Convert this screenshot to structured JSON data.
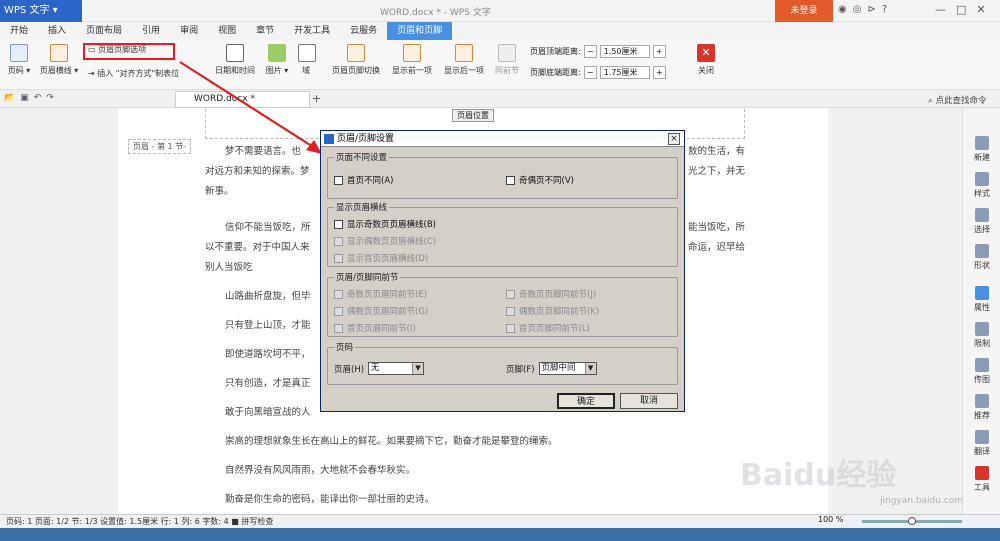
{
  "titlebar": {
    "app": "WPS 文字",
    "doc_title": "WORD.docx * - WPS 文字",
    "login": "未登录"
  },
  "tabs": [
    "开始",
    "插入",
    "页面布局",
    "引用",
    "审阅",
    "视图",
    "章节",
    "开发工具",
    "云服务",
    "页眉和页脚"
  ],
  "active_tab": "页眉和页脚",
  "ribbon": {
    "page_num": "页码",
    "header_line": "页眉横线",
    "insert": "插入",
    "align_tab": "\"对齐方式\"制表位",
    "header_footer_options": "页眉页脚选项",
    "datetime": "日期和时间",
    "picture": "图片",
    "field": "域",
    "switch": "页眉页脚切换",
    "prev": "显示前一项",
    "next": "显示后一项",
    "same_prev": "同前节",
    "header_top_label": "页眉顶端距离:",
    "header_top_value": "1.50厘米",
    "footer_bottom_label": "页脚底端距离:",
    "footer_bottom_value": "1.75厘米",
    "close": "关闭"
  },
  "doc_tab": "WORD.docx *",
  "search": "点此查找命令",
  "document": {
    "header_pos": "页眉位置",
    "header_label": "页眉 - 第 1 节-",
    "paras": [
      "梦不需要语言。也",
      "对远方和未知的探索。梦",
      "新事。",
      "信仰不能当饭吃，所",
      "以不重要。对于中国人来",
      "别人当饭吃",
      "山路曲折盘旋，但毕",
      "只有登上山顶，才能",
      "即使道路坎坷不平，",
      "只有创造，才是真正",
      "敢于向黑暗宣战的人",
      "崇高的理想就象生长在高山上的鲜花。如果要摘下它，勤奋才能是攀登的绳索。",
      "自然界没有风风雨雨，大地就不会春华秋实。",
      "勤奋是你生命的密码，能译出你一部壮丽的史诗。"
    ],
    "right_frags": [
      "敖的生活，有",
      "光之下，并无",
      "能当饭吃，所",
      "命运，迟早给"
    ]
  },
  "dialog": {
    "title": "页眉/页脚设置",
    "g1": "页面不同设置",
    "first_diff": "首页不同(A)",
    "odd_even": "奇偶页不同(V)",
    "g2": "显示页眉横线",
    "show_odd": "显示奇数页页眉横线(B)",
    "show_even": "显示偶数页页眉横线(C)",
    "show_first": "显示首页页眉横线(D)",
    "g3": "页眉/页脚同前节",
    "odd_header_prev": "奇数页页眉同前节(E)",
    "odd_footer_prev": "奇数页页脚同前节(J)",
    "even_header_prev": "偶数页页眉同前节(G)",
    "even_footer_prev": "偶数页页脚同前节(K)",
    "first_header_prev": "首页页眉同前节(I)",
    "first_footer_prev": "首页页脚同前节(L)",
    "g4": "页码",
    "header_label": "页眉(H)",
    "header_value": "无",
    "footer_label": "页脚(F)",
    "footer_value": "页脚中间",
    "ok": "确定",
    "cancel": "取消"
  },
  "sidebar": [
    "新建",
    "样式",
    "选择",
    "形状",
    "属性",
    "限制",
    "传图",
    "推荐",
    "翻译",
    "工具"
  ],
  "status": "页码: 1  页面: 1/2  节: 1/3  设置值: 1.5厘米  行: 1  列: 6  字数: 4  ■ 拼写检查",
  "zoom": "100 %",
  "watermark": "Baidu经验",
  "watermark_url": "jingyan.baidu.com"
}
